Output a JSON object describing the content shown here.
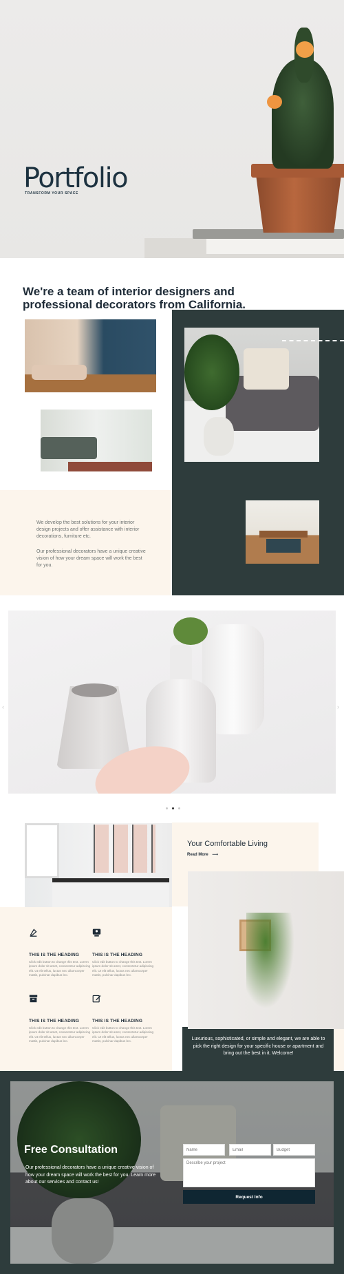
{
  "hero": {
    "title": "Portfolio",
    "subtitle": "TRANSFORM YOUR SPACE"
  },
  "team": {
    "heading": "We're a team of interior designers and professional decorators from California.",
    "paragraph_1": "We develop the best solutions for your interior design projects and offer assistance with interior decorations, furniture etc.",
    "paragraph_2": "Our professional decorators have a unique creative vision of how your dream space will work the best for you."
  },
  "carousel": {
    "arrow_left": "‹",
    "arrow_right": "›",
    "dots": 3,
    "active_dot": 1
  },
  "comfort": {
    "title": "Your Comfortable Living",
    "link_label": "Read More",
    "link_arrow": "⟶",
    "description": "Luxurious, sophisticated, or simple and elegant, we are able to pick the right design for your specific house or apartment and bring out the best in it. Welcome!"
  },
  "features": [
    {
      "icon": "pen-nib-icon",
      "heading": "THIS IS THE HEADING",
      "body": "Click edit button to change this text. Lorem ipsum dolor sit amet, consectetur adipiscing elit. Ut elit tellus, luctus nec ullamcorper mattis, pulvinar dapibus leo."
    },
    {
      "icon": "user-badge-icon",
      "heading": "THIS IS THE HEADING",
      "body": "Click edit button to change this text. Lorem ipsum dolor sit amet, consectetur adipiscing elit. Ut elit tellus, luctus nec ullamcorper mattis, pulvinar dapibus leo."
    },
    {
      "icon": "archive-box-icon",
      "heading": "THIS IS THE HEADING",
      "body": "Click edit button to change this text. Lorem ipsum dolor sit amet, consectetur adipiscing elit. Ut elit tellus, luctus nec ullamcorper mattis, pulvinar dapibus leo."
    },
    {
      "icon": "edit-icon",
      "heading": "THIS IS THE HEADING",
      "body": "Click edit button to change this text. Lorem ipsum dolor sit amet, consectetur adipiscing elit. Ut elit tellus, luctus nec ullamcorper mattis, pulvinar dapibus leo."
    }
  ],
  "consultation": {
    "title": "Free Consultation",
    "text": "Our professional decorators have a unique creative vision of how your dream space will work the best for you. Learn more about our services and contact us!",
    "form": {
      "name_placeholder": "Name",
      "email_placeholder": "Email",
      "budget_placeholder": "Budget",
      "description_placeholder": "Describe your project",
      "submit_label": "Request Info"
    }
  },
  "colors": {
    "dark_teal": "#2e3c3c",
    "cream": "#fcf5ec",
    "navy_text": "#1d3240",
    "button": "#0f2632"
  }
}
